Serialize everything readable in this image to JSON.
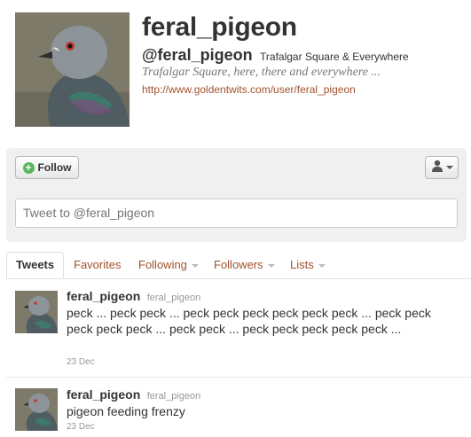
{
  "profile": {
    "name": "feral_pigeon",
    "handle": "@feral_pigeon",
    "location": "Trafalgar Square & Everywhere",
    "bio": "Trafalgar Square, here, there and everywhere ...",
    "url": "http://www.goldentwits.com/user/feral_pigeon"
  },
  "actions": {
    "follow_label": "Follow",
    "tweet_placeholder": "Tweet to @feral_pigeon"
  },
  "tabs": [
    {
      "label": "Tweets"
    },
    {
      "label": "Favorites"
    },
    {
      "label": "Following"
    },
    {
      "label": "Followers"
    },
    {
      "label": "Lists"
    }
  ],
  "tweets": [
    {
      "name": "feral_pigeon",
      "screen_name": "feral_pigeon",
      "text": "peck ... peck peck ... peck peck peck peck peck peck ... peck peck peck peck peck ... peck peck ... peck peck peck peck peck ...",
      "date": "23 Dec"
    },
    {
      "name": "feral_pigeon",
      "screen_name": "feral_pigeon",
      "text": "pigeon feeding frenzy",
      "date": "23 Dec"
    }
  ],
  "colors": {
    "link": "#a0522d",
    "text": "#333333",
    "muted": "#999999",
    "panel": "#f0f0f0",
    "follow_icon": "#5bb75b"
  }
}
